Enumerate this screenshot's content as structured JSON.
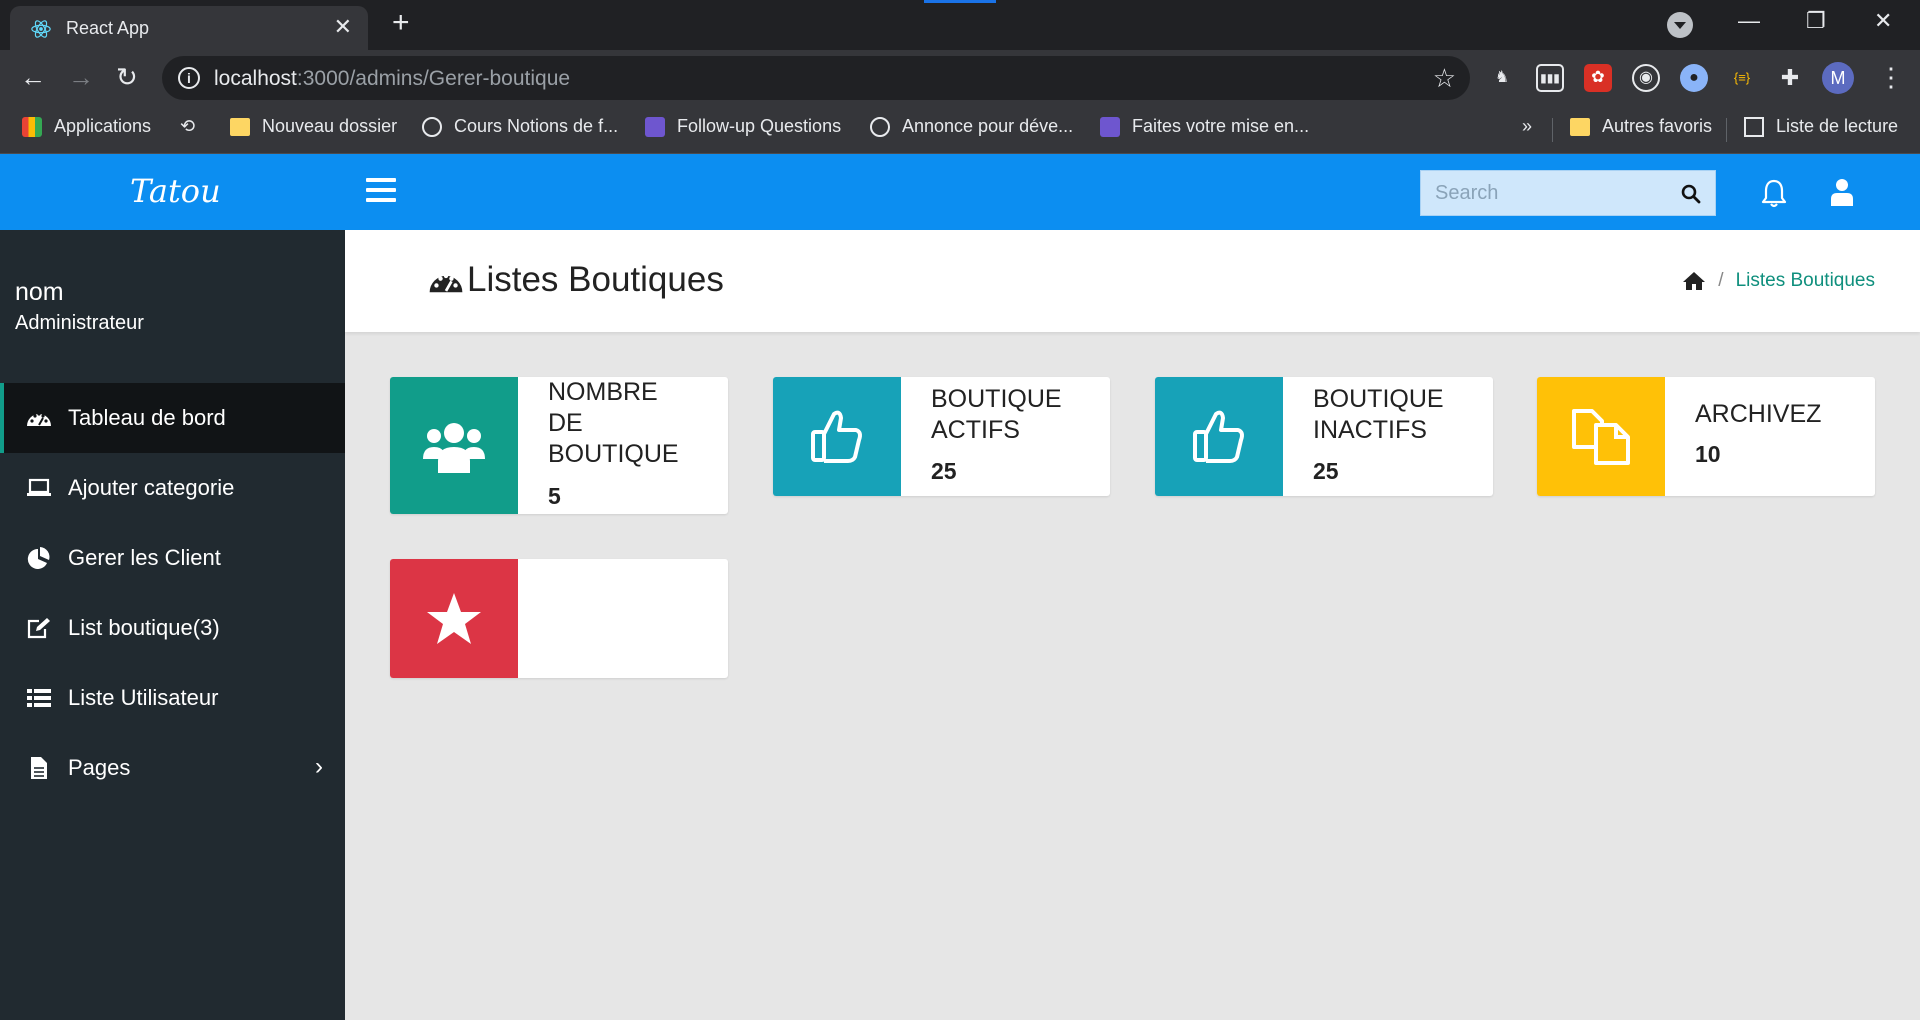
{
  "browser": {
    "tab_title": "React App",
    "tab_close": "✕",
    "new_tab": "+",
    "url_host": "localhost",
    "url_path": ":3000/admins/Gerer-boutique",
    "profile_initial": "M",
    "bookmarks": [
      {
        "label": "Applications",
        "icon": "apps-grid-icon"
      },
      {
        "label": "Nouveau dossier",
        "icon": "folder-icon"
      },
      {
        "label": "Cours Notions de f...",
        "icon": "globe-icon"
      },
      {
        "label": "Follow-up Questions",
        "icon": "app-icon"
      },
      {
        "label": "Annonce pour déve...",
        "icon": "globe-icon"
      },
      {
        "label": "Faites votre mise en...",
        "icon": "app-icon"
      }
    ],
    "bookmarks_more": "»",
    "other_bookmarks": "Autres favoris",
    "reading_list": "Liste de lecture"
  },
  "app": {
    "brand": "Tatou",
    "search_placeholder": "Search",
    "accent": "#0c8ef1",
    "sidebar_bg": "#212a30"
  },
  "sidebar": {
    "user_name": "nom",
    "user_role": "Administrateur",
    "items": [
      {
        "label": "Tableau de bord",
        "icon": "dashboard-icon",
        "active": true
      },
      {
        "label": "Ajouter categorie",
        "icon": "laptop-icon"
      },
      {
        "label": "Gerer les Client",
        "icon": "pie-chart-icon"
      },
      {
        "label": "List boutique(3)",
        "icon": "edit-icon"
      },
      {
        "label": "Liste Utilisateur",
        "icon": "list-icon"
      },
      {
        "label": "Pages",
        "icon": "file-icon",
        "chevron": "›"
      }
    ]
  },
  "page": {
    "title": "Listes Boutiques",
    "breadcrumb_sep": "/",
    "breadcrumb_current": "Listes Boutiques"
  },
  "cards": [
    {
      "label": "NOMBRE DE BOUTIQUE",
      "value": "5",
      "color": "#119d8a",
      "icon": "users-icon"
    },
    {
      "label": "BOUTIQUE ACTIFS",
      "value": "25",
      "color": "#17a2b8",
      "icon": "thumbs-up-icon"
    },
    {
      "label": "BOUTIQUE INACTIFS",
      "value": "25",
      "color": "#17a2b8",
      "icon": "thumbs-up-icon"
    },
    {
      "label": "ARCHIVEZ",
      "value": "10",
      "color": "#ffc107",
      "icon": "copy-icon"
    },
    {
      "label": "",
      "value": "",
      "color": "#dc3545",
      "icon": "star-icon"
    }
  ]
}
